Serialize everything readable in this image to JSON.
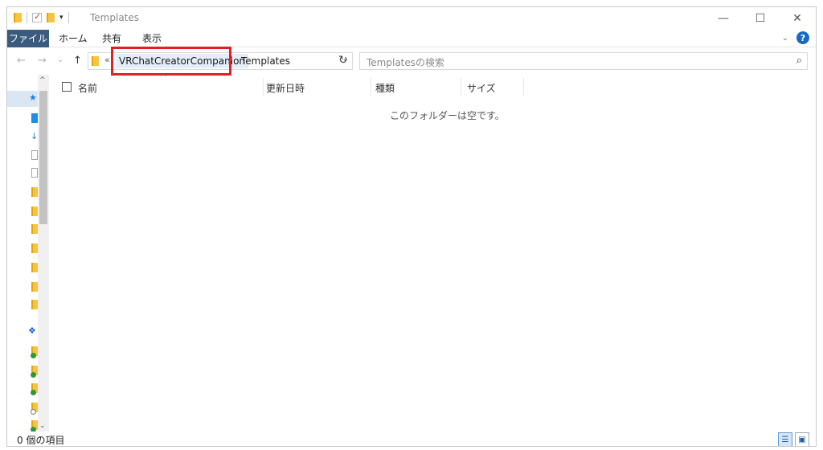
{
  "window": {
    "title": "Templates"
  },
  "icons": {
    "quick_access": "folder-icon",
    "properties": "check-icon",
    "new_folder": "folder-icon",
    "qat_dropdown": "chevron-down-icon",
    "minimize": "minimize-icon",
    "maximize": "maximize-icon",
    "close": "close-icon",
    "back": "arrow-left-icon",
    "forward": "arrow-right-icon",
    "recent": "chevron-down-icon",
    "up": "arrow-up-icon",
    "refresh": "refresh-icon",
    "search": "search-icon",
    "help": "help-icon"
  },
  "glyphs": {
    "minimize": "—",
    "maximize": "☐",
    "close": "✕",
    "back": "←",
    "forward": "→",
    "recent": "⌄",
    "up": "↑",
    "overflow": "«",
    "crumb_sep": "›",
    "addr_dropdown": "⌄",
    "refresh": "↻",
    "search": "⌕",
    "ribbon_collapse": "⌄",
    "help": "?",
    "sort": "^",
    "scroll_up": "^",
    "scroll_down": "⌄",
    "qat_dropdown": "▾",
    "details_view": "☰",
    "large_icons_view": "▣"
  },
  "ribbon": {
    "tabs": [
      {
        "label": "ファイル"
      },
      {
        "label": "ホーム"
      },
      {
        "label": "共有"
      },
      {
        "label": "表示"
      }
    ]
  },
  "address": {
    "breadcrumbs": [
      "VRChatCreatorCompanion",
      "Templates"
    ]
  },
  "search": {
    "placeholder": "Templatesの検索"
  },
  "columns": [
    "名前",
    "更新日時",
    "種類",
    "サイズ"
  ],
  "content": {
    "empty_message": "このフォルダーは空です。"
  },
  "status": {
    "item_count": "0 個の項目"
  },
  "colors": {
    "file_tab": "#3b5b7e",
    "highlight": "#e21f26",
    "crumb_bg": "#e4eef9",
    "help": "#1769c6"
  }
}
